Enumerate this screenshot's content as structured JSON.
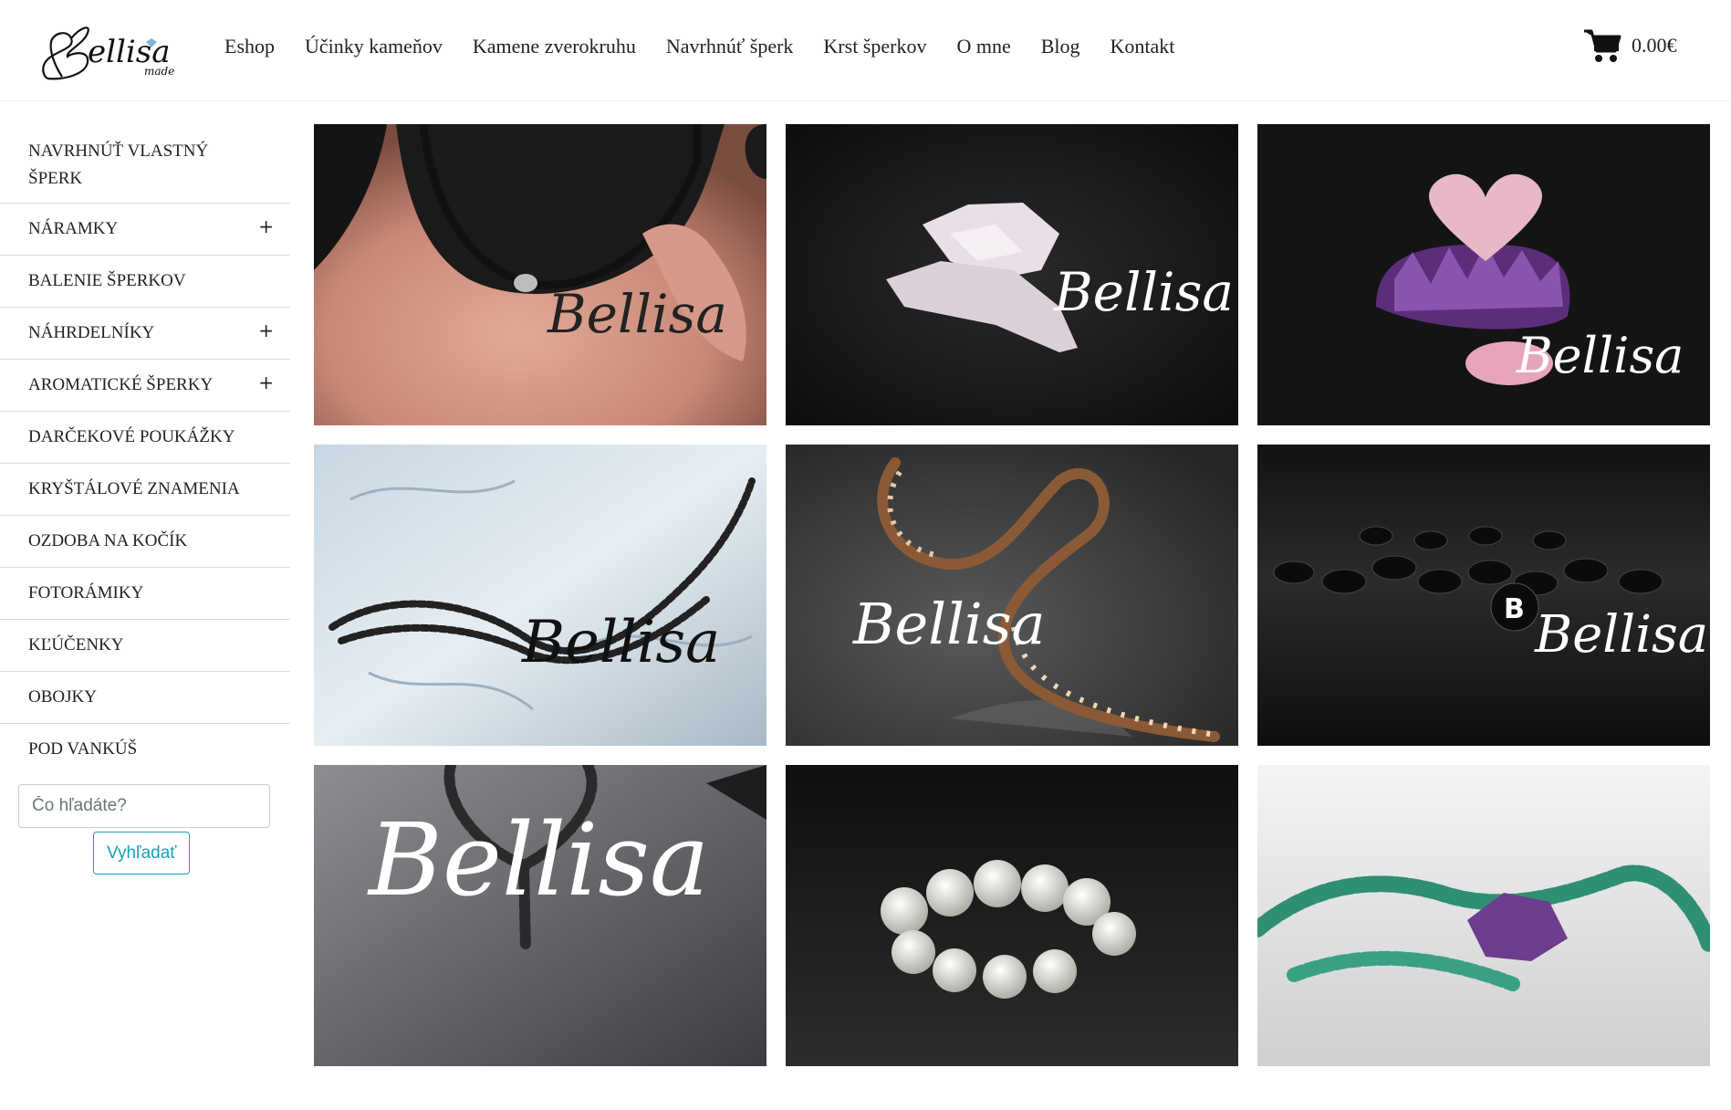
{
  "header": {
    "logo_text": "Bellisa made",
    "nav": [
      "Eshop",
      "Účinky kameňov",
      "Kamene zverokruhu",
      "Navrhnúť šperk",
      "Krst šperkov",
      "O mne",
      "Blog",
      "Kontakt"
    ],
    "cart_total": "0.00€",
    "cart_icon": "shopping-cart-icon"
  },
  "sidebar": {
    "items": [
      {
        "label": "NAVRHNÚŤ VLASTNÝ ŠPERK",
        "has_plus": false
      },
      {
        "label": "NÁRAMKY",
        "has_plus": true
      },
      {
        "label": "BALENIE ŠPERKOV",
        "has_plus": false
      },
      {
        "label": "NÁHRDELNÍKY",
        "has_plus": true
      },
      {
        "label": "AROMATICKÉ ŠPERKY",
        "has_plus": true
      },
      {
        "label": "DARČEKOVÉ POUKÁŽKY",
        "has_plus": false
      },
      {
        "label": "KRYŠTÁLOVÉ ZNAMENIA",
        "has_plus": false
      },
      {
        "label": "OZDOBA NA KOČÍK",
        "has_plus": false
      },
      {
        "label": "FOTORÁMIKY",
        "has_plus": false
      },
      {
        "label": "KĽÚČENKY",
        "has_plus": false
      },
      {
        "label": "OBOJKY",
        "has_plus": false
      },
      {
        "label": "POD VANKÚŠ",
        "has_plus": false
      }
    ],
    "plus_symbol": "+",
    "search_placeholder": "Čo hľadáte?",
    "search_button": "Vyhľadať"
  },
  "grid": {
    "watermark_text": "Bellisa",
    "tiles": [
      {
        "subject": "black bead necklace on neck"
      },
      {
        "subject": "rose quartz raw crystals"
      },
      {
        "subject": "rose quartz heart on amethyst"
      },
      {
        "subject": "black bead necklace on stone"
      },
      {
        "subject": "wooden bead necklace"
      },
      {
        "subject": "black letter beads"
      },
      {
        "subject": "lava bead heart necklace"
      },
      {
        "subject": "pearl bracelet"
      },
      {
        "subject": "turquoise chips and amethyst"
      }
    ]
  }
}
